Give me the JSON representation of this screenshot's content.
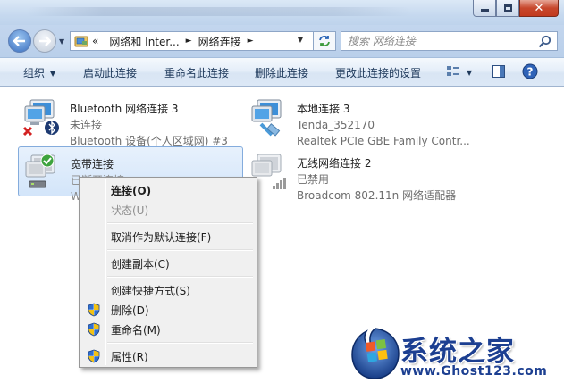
{
  "window": {
    "address": {
      "overflow": "«",
      "crumbs": [
        "网络和 Inter...",
        "网络连接"
      ]
    },
    "search": {
      "placeholder": "搜索 网络连接"
    }
  },
  "toolbar": {
    "organize": "组织",
    "items": [
      "启动此连接",
      "重命名此连接",
      "删除此连接",
      "更改此连接的设置"
    ]
  },
  "connections": [
    {
      "name": "Bluetooth 网络连接 3",
      "status": "未连接",
      "device": "Bluetooth 设备(个人区域网) #3",
      "icon": "bluetooth-network-icon"
    },
    {
      "name": "本地连接 3",
      "status": "Tenda_352170",
      "device": "Realtek PCIe GBE Family Contr...",
      "icon": "ethernet-network-icon"
    },
    {
      "name": "宽带连接",
      "status": "已断开连接",
      "device": "W",
      "icon": "broadband-network-icon"
    },
    {
      "name": "无线网络连接 2",
      "status": "已禁用",
      "device": "Broadcom 802.11n 网络适配器",
      "icon": "wireless-network-icon"
    }
  ],
  "context_menu": {
    "items": [
      {
        "label": "连接(O)",
        "bold": true
      },
      {
        "label": "状态(U)",
        "disabled": true
      },
      {
        "label": "取消作为默认连接(F)"
      },
      {
        "label": "创建副本(C)"
      },
      {
        "label": "创建快捷方式(S)"
      },
      {
        "label": "删除(D)",
        "shield": true
      },
      {
        "label": "重命名(M)",
        "shield": true
      },
      {
        "label": "属性(R)",
        "shield": true
      }
    ]
  },
  "watermark": {
    "title": "系统之家",
    "url": "www.Ghost123.com"
  },
  "colors": {
    "accent": "#1c3f91",
    "selection": "#d3e5fa",
    "toolbar_text": "#1e395b"
  }
}
